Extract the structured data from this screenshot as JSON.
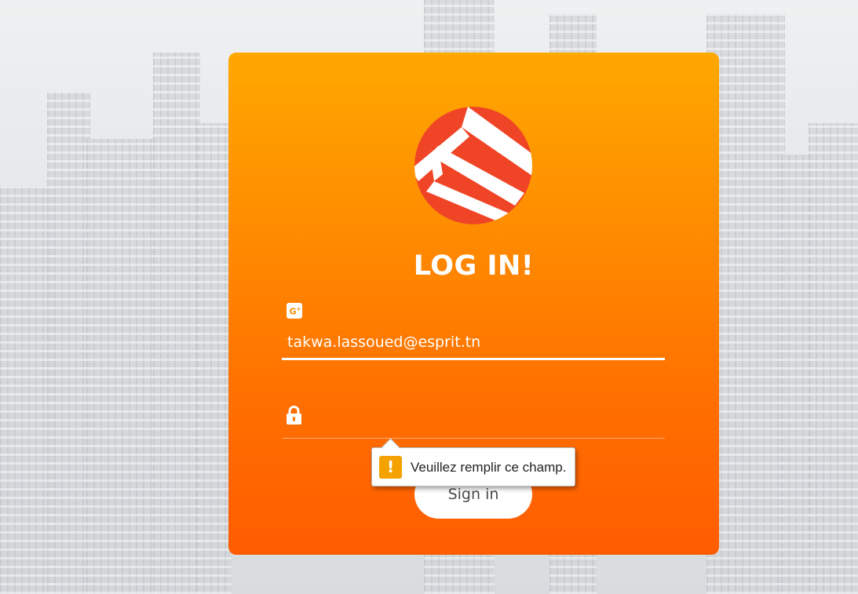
{
  "login": {
    "title": "LOG IN!",
    "email_value": "takwa.lassoued@esprit.tn",
    "email_icon": "google-plus-icon",
    "password_value": "",
    "password_icon": "lock-icon",
    "signin_label": "Sign in"
  },
  "validation": {
    "message": "Veuillez remplir ce champ.",
    "icon": "warning-icon",
    "icon_glyph": "!"
  },
  "colors": {
    "card_gradient_top": "#ffa800",
    "card_gradient_bottom": "#ff5c00",
    "logo_red": "#f04427",
    "warning": "#f4a200"
  }
}
